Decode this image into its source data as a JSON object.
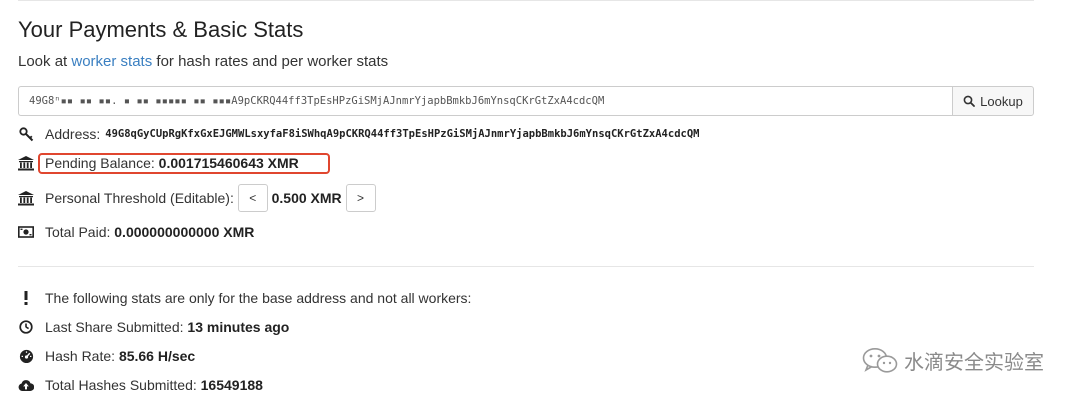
{
  "header": {
    "title": "Your Payments & Basic Stats",
    "subtitle_prefix": "Look at ",
    "subtitle_link": "worker stats",
    "subtitle_suffix": " for hash rates and per worker stats"
  },
  "lookup": {
    "input_value": "49G8ⁿ▪▪ ▪▪ ▪▪. ▪ ▪▪ ▪▪▪▪▪ ▪▪ ▪▪▪A9pCKRQ44ff3TpEsHPzGiSMjAJnmrYjapbBmkbJ6mYnsqCKrGtZxA4cdcQM",
    "button_label": "Lookup",
    "button_icon": "search-icon"
  },
  "stats": {
    "address_label": "Address:",
    "address_value": "49G8qGyCUpRgKfxGxEJGMWLsxyfaF8iSWhqA9pCKRQ44ff3TpEsHPzGiSMjAJnmrYjapbBmkbJ6mYnsqCKrGtZxA4cdcQM",
    "pending_label": "Pending Balance:",
    "pending_value": "0.001715460643 XMR",
    "threshold_label": "Personal Threshold (Editable):",
    "threshold_decrease": "<",
    "threshold_value": "0.500 XMR",
    "threshold_increase": ">",
    "paid_label": "Total Paid:",
    "paid_value": "0.000000000000 XMR"
  },
  "base_stats": {
    "notice": "The following stats are only for the base address and not all workers:",
    "last_share_label": "Last Share Submitted:",
    "last_share_value": "13 minutes ago",
    "hash_rate_label": "Hash Rate:",
    "hash_rate_value": "85.66 H/sec",
    "total_hashes_label": "Total Hashes Submitted:",
    "total_hashes_value": "16549188"
  },
  "watermark": {
    "text": "水滴安全实验室",
    "icon": "wechat-icon"
  },
  "colors": {
    "link": "#3a7fc1",
    "highlight": "#e0462f"
  }
}
